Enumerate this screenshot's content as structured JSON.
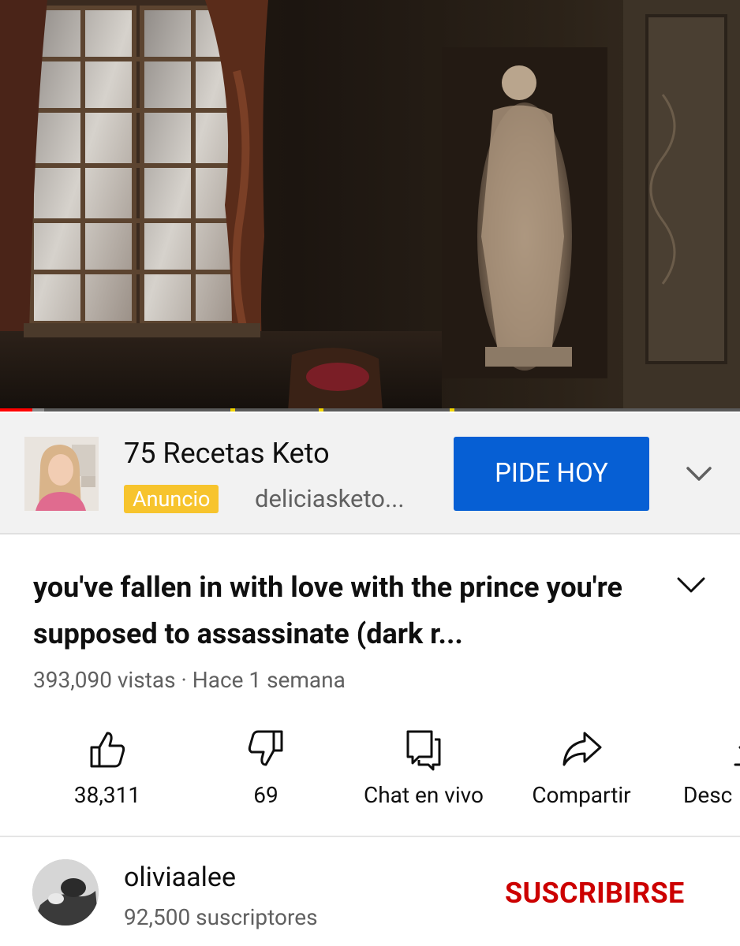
{
  "player": {
    "progress_fraction": 0.044,
    "buffered_fraction": 0.06
  },
  "ad": {
    "title": "75 Recetas Keto",
    "badge": "Anuncio",
    "domain": "deliciasketo...",
    "cta_label": "PIDE HOY",
    "badge_color": "#f7c42d",
    "cta_color": "#065fd4"
  },
  "video": {
    "title": "you've fallen in with love with the prince you're supposed to assassinate (dark r...",
    "meta": "393,090 vistas · Hace 1 semana"
  },
  "actions": [
    {
      "icon": "thumbs-up-icon",
      "label": "38,311"
    },
    {
      "icon": "thumbs-down-icon",
      "label": "69"
    },
    {
      "icon": "live-chat-icon",
      "label": "Chat en vivo"
    },
    {
      "icon": "share-icon",
      "label": "Compartir"
    },
    {
      "icon": "download-icon",
      "label": "Desc"
    }
  ],
  "channel": {
    "name": "oliviaalee",
    "subscribers": "92,500 suscriptores",
    "subscribe_label": "SUSCRIBIRSE",
    "subscribe_color": "#cc0000"
  }
}
